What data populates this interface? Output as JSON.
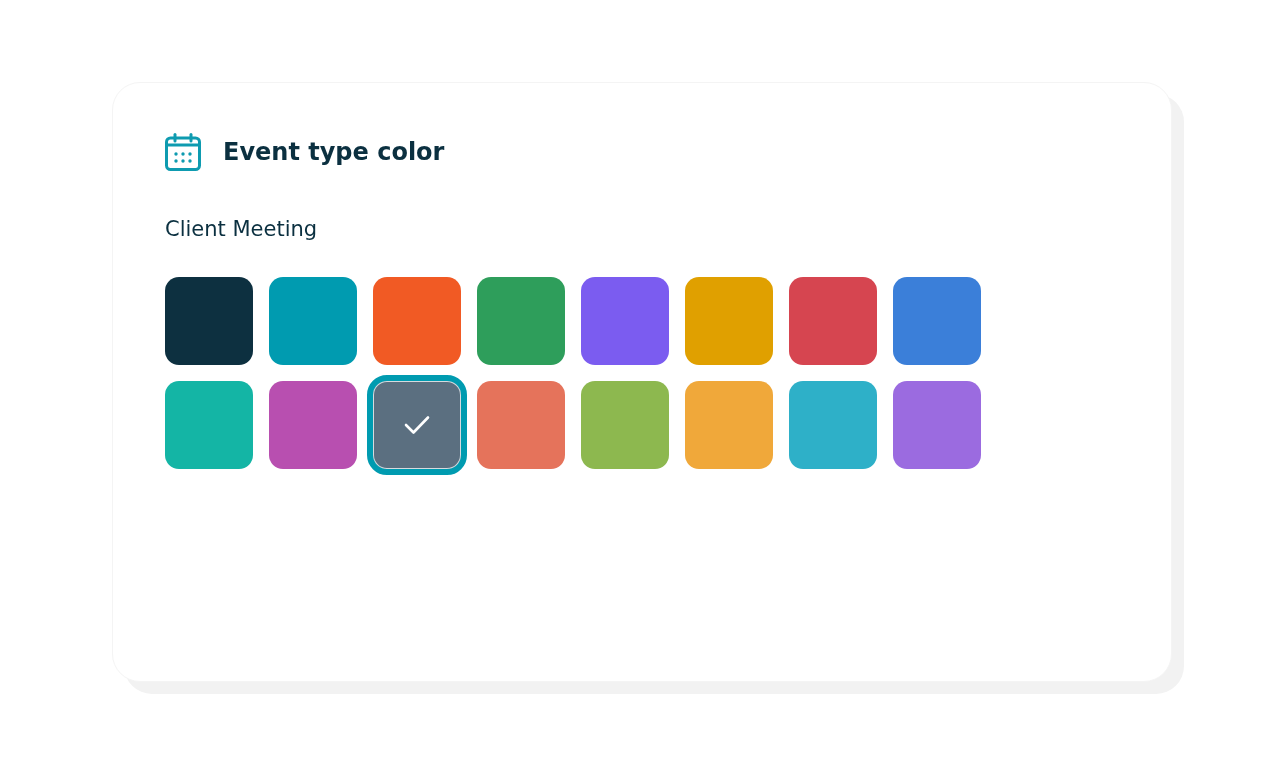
{
  "card": {
    "title": "Event type color",
    "label": "Client Meeting",
    "swatches": [
      {
        "color": "#0d3040",
        "selected": false
      },
      {
        "color": "#009bb0",
        "selected": false
      },
      {
        "color": "#f15a24",
        "selected": false
      },
      {
        "color": "#2e9e5b",
        "selected": false
      },
      {
        "color": "#7b5cf0",
        "selected": false
      },
      {
        "color": "#e0a000",
        "selected": false
      },
      {
        "color": "#d64550",
        "selected": false
      },
      {
        "color": "#3b7fd9",
        "selected": false
      },
      {
        "color": "#14b5a5",
        "selected": false
      },
      {
        "color": "#b84fb0",
        "selected": false
      },
      {
        "color": "#5b6f80",
        "selected": true
      },
      {
        "color": "#e5735b",
        "selected": false
      },
      {
        "color": "#8db84f",
        "selected": false
      },
      {
        "color": "#f0a83a",
        "selected": false
      },
      {
        "color": "#2eb0c8",
        "selected": false
      },
      {
        "color": "#9b6be0",
        "selected": false
      }
    ]
  }
}
